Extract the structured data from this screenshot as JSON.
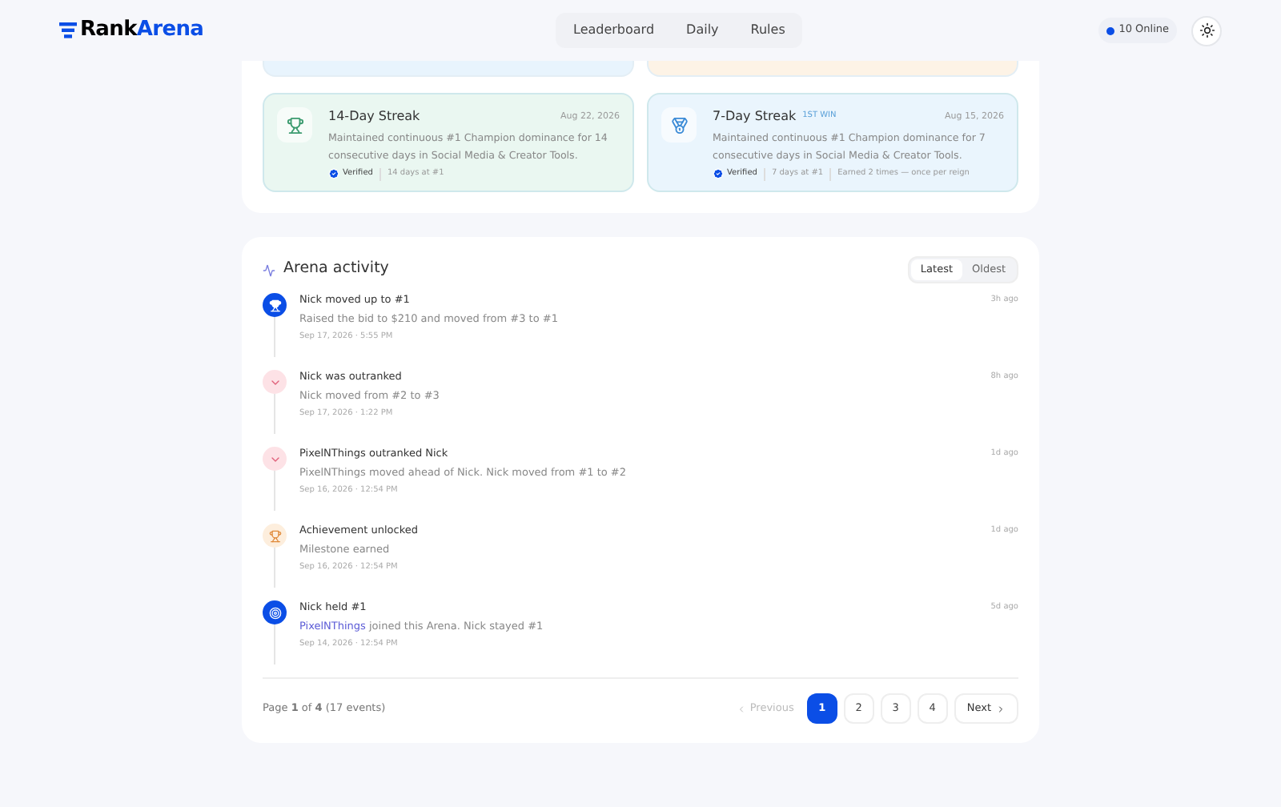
{
  "header": {
    "logo": {
      "first": "Rank",
      "second": "Arena"
    },
    "nav": [
      {
        "label": "Leaderboard",
        "selected": false
      },
      {
        "label": "Daily",
        "selected": false
      },
      {
        "label": "Rules",
        "selected": false
      }
    ],
    "online": "10 Online"
  },
  "achievements": [
    {
      "color": "#e8f4fd"
    },
    {
      "color": "#fdf3e6"
    },
    {
      "color": "#eaf7f1",
      "kind": "trophy",
      "title": "14-Day Streak",
      "date": "Aug 22, 2026",
      "text": "Maintained continuous #1 Champion dominance for 14 consecutive days in Social Media & Creator Tools.",
      "meta": [
        "Verified",
        "14 days at #1"
      ]
    },
    {
      "color": "#eaf5fd",
      "kind": "medal",
      "title": "7-Day Streak",
      "badge": "1ST WIN",
      "date": "Aug 15, 2026",
      "text": "Maintained continuous #1 Champion dominance for 7 consecutive days in Social Media & Creator Tools.",
      "meta": [
        "Verified",
        "7 days at #1",
        "Earned 2 times — once per reign"
      ]
    }
  ],
  "activity": {
    "title": "Arena activity",
    "sort": [
      {
        "label": "Latest",
        "selected": true
      },
      {
        "label": "Oldest",
        "selected": false
      }
    ],
    "events": [
      {
        "kind": "up",
        "title": "Nick moved up to #1",
        "text": "Raised the bid to $210 and moved from #3 to #1",
        "date": "Sep 17, 2026 · 5:55 PM",
        "ago": "3h ago"
      },
      {
        "kind": "down",
        "title": "Nick was outranked",
        "text": "Nick moved from #2 to #3",
        "date": "Sep 17, 2026 · 1:22 PM",
        "ago": "8h ago"
      },
      {
        "kind": "down",
        "title": "PixelNThings outranked Nick",
        "text": "PixelNThings moved ahead of Nick. Nick moved from #1 to #2",
        "date": "Sep 16, 2026 · 12:54 PM",
        "ago": "1d ago"
      },
      {
        "kind": "achievement",
        "title": "Achievement unlocked",
        "text": "Milestone earned",
        "date": "Sep 16, 2026 · 12:54 PM",
        "ago": "1d ago"
      },
      {
        "kind": "held",
        "title": "Nick held #1",
        "link": "PixelNThings",
        "text": " joined this Arena. Nick stayed #1",
        "date": "Sep 14, 2026 · 12:54 PM",
        "ago": "5d ago"
      }
    ],
    "page_info": "Page **1** of **4** (17 events)",
    "previous": "Previous",
    "pages": [
      {
        "label": "1",
        "selected": true
      },
      {
        "label": "2",
        "selected": false
      },
      {
        "label": "3",
        "selected": false
      },
      {
        "label": "4",
        "selected": false
      }
    ],
    "next": "Next"
  }
}
